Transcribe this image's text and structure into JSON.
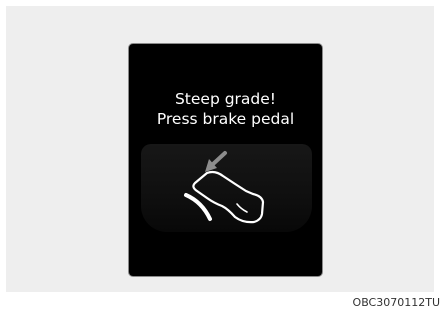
{
  "display": {
    "message_line1": "Steep grade!",
    "message_line2": "Press brake pedal",
    "icon": "foot-pressing-brake-pedal-icon"
  },
  "figure": {
    "code": "OBC3070112TU"
  },
  "colors": {
    "screen": "#000000",
    "text": "#ffffff",
    "backdrop": "#eeeeee"
  }
}
